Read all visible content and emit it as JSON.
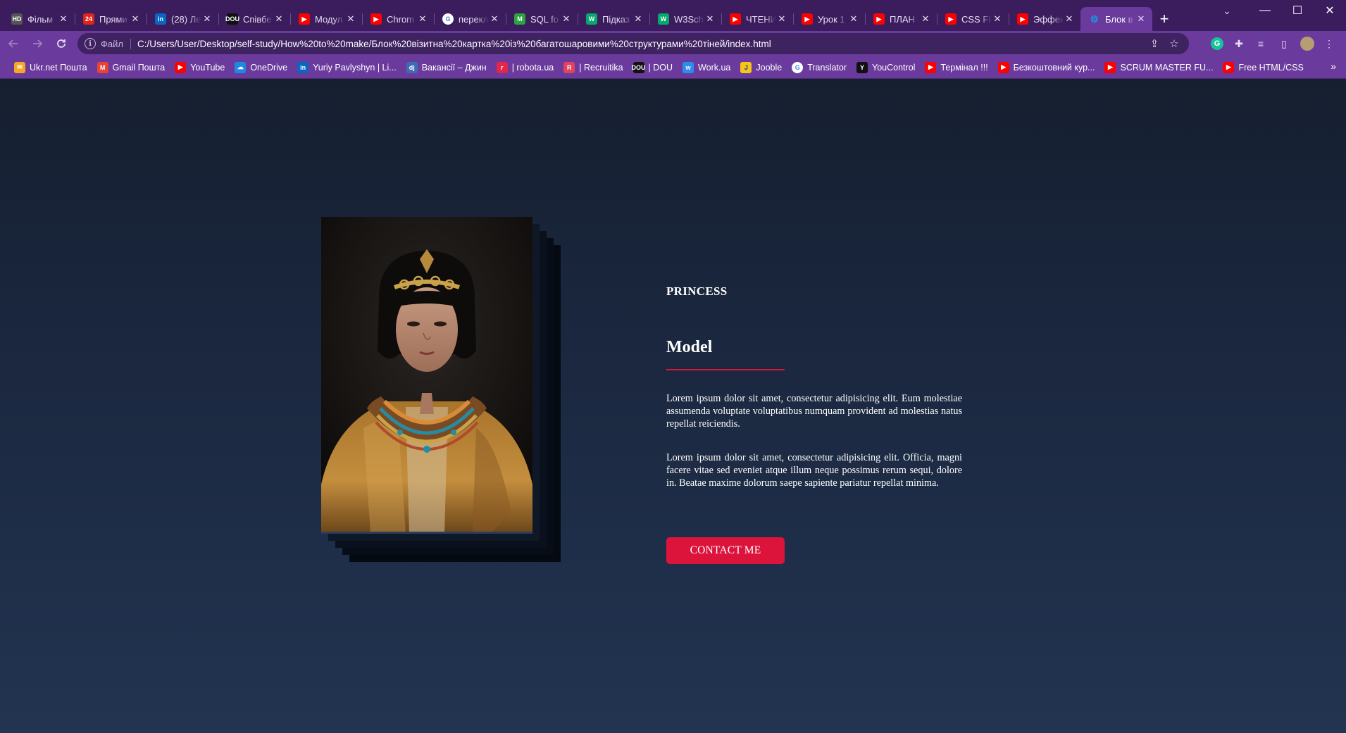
{
  "browser": {
    "tabs": [
      {
        "title": "Фільм",
        "favicon": "hd-icon",
        "color": "#555555",
        "glyph": "HD"
      },
      {
        "title": "Прями",
        "favicon": "24-icon",
        "color": "#e2231a",
        "glyph": "24"
      },
      {
        "title": "(28) Ле",
        "favicon": "linkedin-icon",
        "color": "#0a66c2",
        "glyph": "in"
      },
      {
        "title": "Співбе",
        "favicon": "dou-icon",
        "color": "#111111",
        "glyph": "DOU"
      },
      {
        "title": "Модул",
        "favicon": "youtube-icon",
        "color": "#ff0000",
        "glyph": "▶"
      },
      {
        "title": "Chrom",
        "favicon": "youtube-icon",
        "color": "#ff0000",
        "glyph": "▶"
      },
      {
        "title": "перекл",
        "favicon": "google-icon",
        "color": "#ffffff",
        "glyph": "G"
      },
      {
        "title": "SQL fo",
        "favicon": "m-icon",
        "color": "#2aa43d",
        "glyph": "M"
      },
      {
        "title": "Підказ",
        "favicon": "w3-icon",
        "color": "#04aa6d",
        "glyph": "W"
      },
      {
        "title": "W3Sch",
        "favicon": "w3-icon",
        "color": "#04aa6d",
        "glyph": "W"
      },
      {
        "title": "ЧТЕНИ",
        "favicon": "youtube-icon",
        "color": "#ff0000",
        "glyph": "▶"
      },
      {
        "title": "Урок 1",
        "favicon": "youtube-icon",
        "color": "#ff0000",
        "glyph": "▶"
      },
      {
        "title": "ПЛАН",
        "favicon": "youtube-icon",
        "color": "#ff0000",
        "glyph": "▶"
      },
      {
        "title": "CSS Fle",
        "favicon": "youtube-icon",
        "color": "#ff0000",
        "glyph": "▶"
      },
      {
        "title": "Эффек",
        "favicon": "youtube-icon",
        "color": "#ff0000",
        "glyph": "▶"
      },
      {
        "title": "Блок в",
        "favicon": "globe-icon",
        "color": "#e8ddf4",
        "glyph": "🌐",
        "active": true
      }
    ],
    "address": {
      "scheme_label": "Файл",
      "url": "C:/Users/User/Desktop/self-study/How%20to%20make/Блок%20візитна%20картка%20із%20багатошаровими%20структурами%20тіней/index.html"
    },
    "bookmarks": [
      {
        "label": "Ukr.net Пошта",
        "icon": "ukrnet-icon",
        "color": "#f6a623",
        "glyph": "✉"
      },
      {
        "label": "Gmail Пошта",
        "icon": "gmail-icon",
        "color": "#ea4335",
        "glyph": "M"
      },
      {
        "label": "YouTube",
        "icon": "youtube-icon",
        "color": "#ff0000",
        "glyph": "▶"
      },
      {
        "label": "OneDrive",
        "icon": "onedrive-icon",
        "color": "#1e88e5",
        "glyph": "☁"
      },
      {
        "label": "Yuriy Pavlyshyn | Li...",
        "icon": "linkedin-icon",
        "color": "#0a66c2",
        "glyph": "in"
      },
      {
        "label": "Вакансії – Джин",
        "icon": "djinni-icon",
        "color": "#3d6cb5",
        "glyph": "dj"
      },
      {
        "label": "| robota.ua",
        "icon": "robota-icon",
        "color": "#e3264a",
        "glyph": "r"
      },
      {
        "label": "| Recruitika",
        "icon": "recruitika-icon",
        "color": "#e0435c",
        "glyph": "R"
      },
      {
        "label": "| DOU",
        "icon": "dou-icon",
        "color": "#111111",
        "glyph": "DOU"
      },
      {
        "label": "Work.ua",
        "icon": "workua-icon",
        "color": "#2d8cf0",
        "glyph": "w"
      },
      {
        "label": "Jooble",
        "icon": "jooble-icon",
        "color": "#f5c518",
        "glyph": "J"
      },
      {
        "label": "Translator",
        "icon": "google-icon",
        "color": "#ffffff",
        "glyph": "G"
      },
      {
        "label": "YouControl",
        "icon": "youcontrol-icon",
        "color": "#111111",
        "glyph": "Y"
      },
      {
        "label": "Термінал !!!",
        "icon": "youtube-icon",
        "color": "#ff0000",
        "glyph": "▶"
      },
      {
        "label": "Безкоштовний кур...",
        "icon": "youtube-icon",
        "color": "#ff0000",
        "glyph": "▶"
      },
      {
        "label": "SCRUM MASTER FU...",
        "icon": "youtube-icon",
        "color": "#ff0000",
        "glyph": "▶"
      },
      {
        "label": "Free HTML/CSS",
        "icon": "youtube-icon",
        "color": "#ff0000",
        "glyph": "▶"
      }
    ]
  },
  "card": {
    "subtitle": "PRINCESS",
    "title": "Model",
    "paragraphs": [
      "Lorem ipsum dolor sit amet, consectetur adipisicing elit. Eum molestiae assumenda voluptate voluptatibus numquam provident ad molestias natus repellat reiciendis.",
      "Lorem ipsum dolor sit amet, consectetur adipisicing elit. Officia, magni facere vitae sed eveniet atque illum neque possimus rerum sequi, dolore in. Beatae maxime dolorum saepe sapiente pariatur repellat minima."
    ],
    "button_label": "CONTACT ME",
    "accent_color": "#dc143c",
    "shadow_colors": [
      "#0f1827",
      "#0a111d",
      "#070d17",
      "#050a12"
    ]
  }
}
